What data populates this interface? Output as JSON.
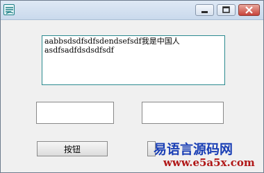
{
  "window": {
    "title": "",
    "memo_text": "aabbsdsdfsdfsdendsefsdf我是中国人\nasdfsadfdsdsdfsdf"
  },
  "fields": {
    "left_value": "",
    "right_value": ""
  },
  "buttons": {
    "main_label": "按钮",
    "partial_label": ""
  },
  "watermark": {
    "title": "易语言源码网",
    "url": "www.e5a5x.com"
  },
  "colors": {
    "memo_border": "#2a8a8f",
    "watermark_title": "#1a3fb5",
    "watermark_url": "#b01616",
    "close_button": "#c7433a"
  }
}
